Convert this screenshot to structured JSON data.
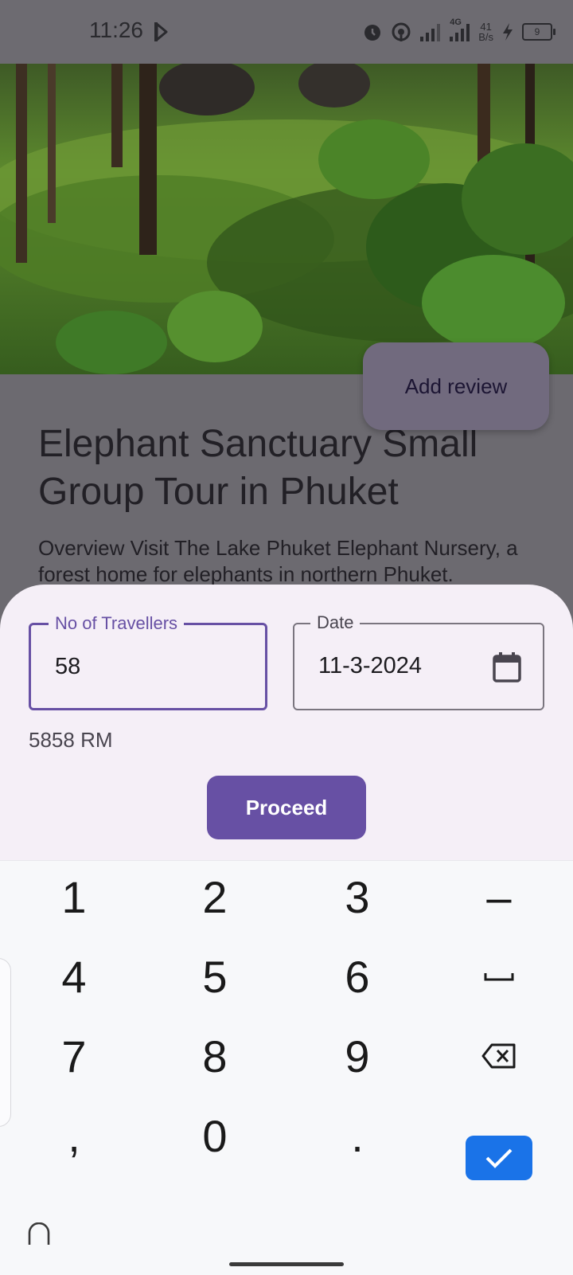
{
  "status_bar": {
    "time": "11:26",
    "network": "4G",
    "speed_value": "41",
    "speed_unit": "B/s",
    "battery": "9"
  },
  "hero": {
    "alt": "Elephants in a green forest"
  },
  "tour": {
    "title": "Elephant Sanctuary Small Group Tour in Phuket",
    "overview": "Overview Visit The Lake Phuket Elephant Nursery, a forest home for elephants in northern Phuket."
  },
  "add_review_label": "Add review",
  "booking": {
    "travellers_label": "No of Travellers",
    "travellers_value": "58",
    "date_label": "Date",
    "date_value": "11-3-2024",
    "price": "5858 RM",
    "proceed_label": "Proceed"
  },
  "keyboard": {
    "keys": {
      "k1": "1",
      "k2": "2",
      "k3": "3",
      "minus": "–",
      "k4": "4",
      "k5": "5",
      "k6": "6",
      "k7": "7",
      "k8": "8",
      "k9": "9",
      "comma": ",",
      "k0": "0",
      "dot": "."
    }
  },
  "colors": {
    "primary": "#6750a4",
    "done_key": "#1a73e8",
    "sheet_background": "#f5eff7"
  }
}
